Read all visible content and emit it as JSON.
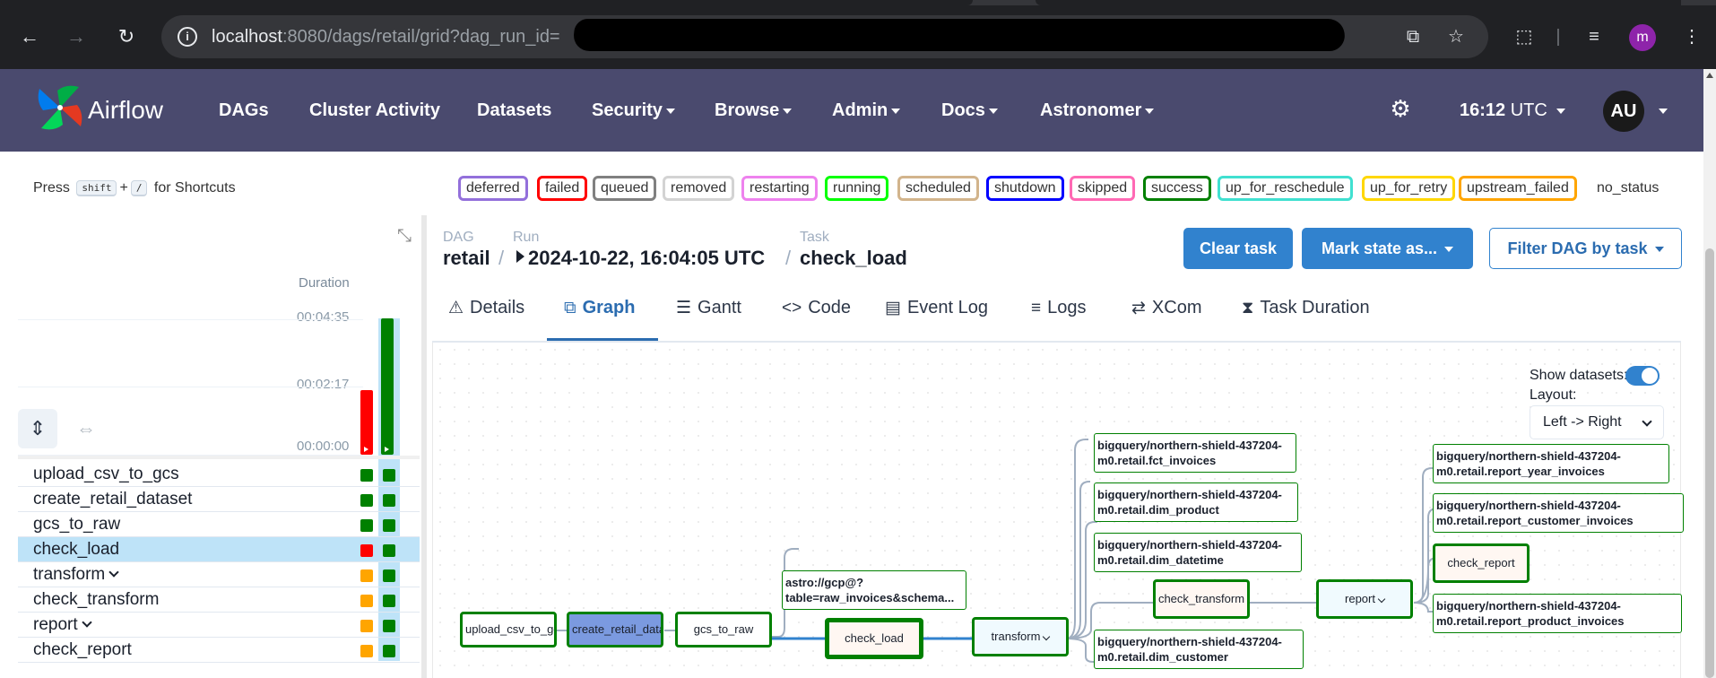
{
  "browser": {
    "url_host": "localhost",
    "url_path": ":8080/dags/retail/grid?dag_run_id=",
    "profile_initial": "m"
  },
  "navbar": {
    "brand": "Airflow",
    "items": [
      {
        "label": "DAGs",
        "dropdown": false
      },
      {
        "label": "Cluster Activity",
        "dropdown": false
      },
      {
        "label": "Datasets",
        "dropdown": false
      },
      {
        "label": "Security",
        "dropdown": true
      },
      {
        "label": "Browse",
        "dropdown": true
      },
      {
        "label": "Admin",
        "dropdown": true
      },
      {
        "label": "Docs",
        "dropdown": true
      },
      {
        "label": "Astronomer",
        "dropdown": true
      }
    ],
    "time": "16:12",
    "timezone": "UTC",
    "user_initials": "AU"
  },
  "shortcut": {
    "prefix": "Press",
    "key1": "shift",
    "plus": "+",
    "key2": "/",
    "suffix": "for Shortcuts"
  },
  "legend": [
    {
      "label": "deferred",
      "color": "#9370db"
    },
    {
      "label": "failed",
      "color": "#ff0000"
    },
    {
      "label": "queued",
      "color": "#808080"
    },
    {
      "label": "removed",
      "color": "#d3d3d3"
    },
    {
      "label": "restarting",
      "color": "#ee82ee"
    },
    {
      "label": "running",
      "color": "#00ff00"
    },
    {
      "label": "scheduled",
      "color": "#d2b48c"
    },
    {
      "label": "shutdown",
      "color": "#0000ff"
    },
    {
      "label": "skipped",
      "color": "#ff69b4"
    },
    {
      "label": "success",
      "color": "#008000"
    },
    {
      "label": "up_for_reschedule",
      "color": "#40e0d0"
    },
    {
      "label": "up_for_retry",
      "color": "#ffd700"
    },
    {
      "label": "upstream_failed",
      "color": "#ffa500"
    },
    {
      "label": "no_status",
      "color": "transparent"
    }
  ],
  "grid": {
    "duration_title": "Duration",
    "duration_labels": [
      "00:04:35",
      "00:02:17",
      "00:00:00"
    ],
    "runs": [
      {
        "duration_seconds": 131,
        "state": "failed",
        "color": "#ff0000"
      },
      {
        "duration_seconds": 275,
        "state": "success",
        "color": "#008000"
      }
    ],
    "tasks": [
      {
        "name": "upload_csv_to_gcs",
        "group": false,
        "states": [
          "#008000",
          "#008000"
        ]
      },
      {
        "name": "create_retail_dataset",
        "group": false,
        "states": [
          "#008000",
          "#008000"
        ]
      },
      {
        "name": "gcs_to_raw",
        "group": false,
        "states": [
          "#008000",
          "#008000"
        ]
      },
      {
        "name": "check_load",
        "group": false,
        "states": [
          "#ff0000",
          "#008000"
        ]
      },
      {
        "name": "transform",
        "group": true,
        "states": [
          "#ffa500",
          "#008000"
        ]
      },
      {
        "name": "check_transform",
        "group": false,
        "states": [
          "#ffa500",
          "#008000"
        ]
      },
      {
        "name": "report",
        "group": true,
        "states": [
          "#ffa500",
          "#008000"
        ]
      },
      {
        "name": "check_report",
        "group": false,
        "states": [
          "#ffa500",
          "#008000"
        ]
      }
    ]
  },
  "breadcrumb": {
    "dag_label": "DAG",
    "dag_value": "retail",
    "run_label": "Run",
    "run_value": "2024-10-22, 16:04:05 UTC",
    "task_label": "Task",
    "task_value": "check_load"
  },
  "actions": {
    "clear": "Clear task",
    "mark": "Mark state as...",
    "filter": "Filter DAG by task"
  },
  "tabs": [
    {
      "label": "Details",
      "icon": "warning-triangle-icon",
      "glyph": "⚠"
    },
    {
      "label": "Graph",
      "icon": "graph-icon",
      "glyph": "⧉"
    },
    {
      "label": "Gantt",
      "icon": "gantt-icon",
      "glyph": "☰"
    },
    {
      "label": "Code",
      "icon": "code-icon",
      "glyph": "<>"
    },
    {
      "label": "Event Log",
      "icon": "calendar-icon",
      "glyph": "▤"
    },
    {
      "label": "Logs",
      "icon": "logs-icon",
      "glyph": "≡"
    },
    {
      "label": "XCom",
      "icon": "exchange-icon",
      "glyph": "⇄"
    },
    {
      "label": "Task Duration",
      "icon": "hourglass-icon",
      "glyph": "⧗"
    }
  ],
  "graph": {
    "show_datasets_label": "Show datasets:",
    "show_datasets": true,
    "layout_label": "Layout:",
    "layout_value": "Left -> Right",
    "nodes": {
      "upload": "upload_csv_to_gcs",
      "create": "create_retail_dataset",
      "gcs": "gcs_to_raw",
      "check_load": "check_load",
      "transform": "transform",
      "check_transform": "check_transform",
      "report": "report",
      "check_report": "check_report",
      "ds_raw": "astro://gcp@?table=raw_invoices&schema...",
      "ds_fct_invoices": "bigquery/northern-shield-437204-m0.retail.fct_invoices",
      "ds_dim_product": "bigquery/northern-shield-437204-m0.retail.dim_product",
      "ds_dim_datetime": "bigquery/northern-shield-437204-m0.retail.dim_datetime",
      "ds_dim_customer": "bigquery/northern-shield-437204-m0.retail.dim_customer",
      "ds_report_year": "bigquery/northern-shield-437204-m0.retail.report_year_invoices",
      "ds_report_customer": "bigquery/northern-shield-437204-m0.retail.report_customer_invoices",
      "ds_report_product": "bigquery/northern-shield-437204-m0.retail.report_product_invoices"
    }
  }
}
